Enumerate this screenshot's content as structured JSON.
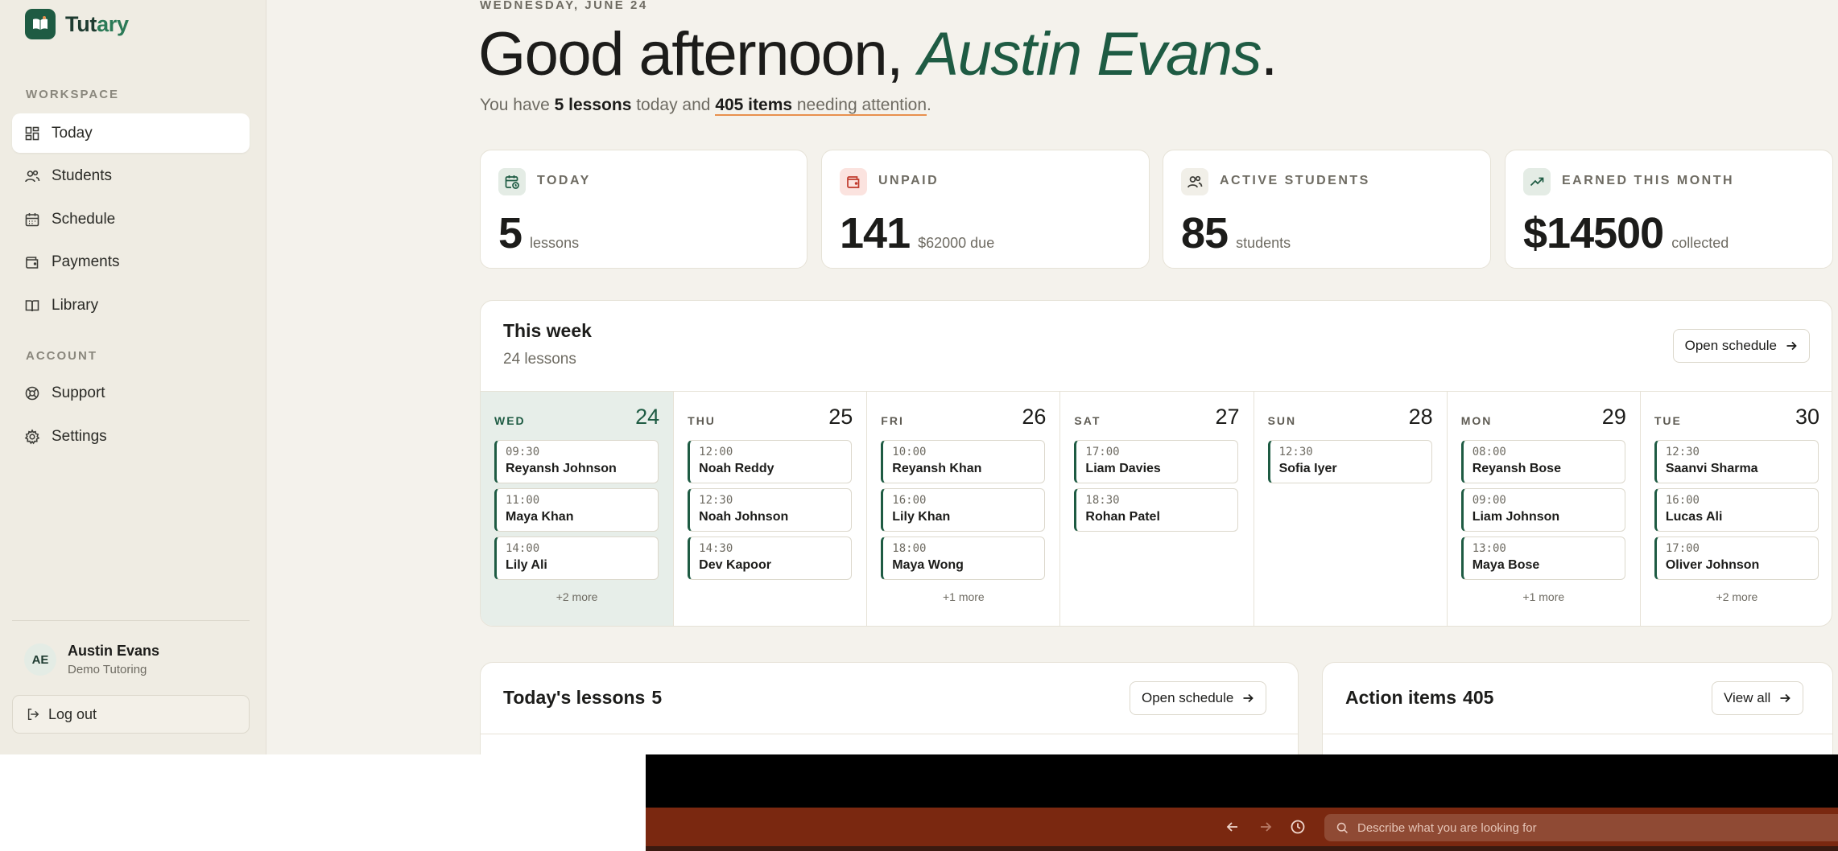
{
  "brand": {
    "name_start": "Tut",
    "name_end": "ary"
  },
  "sidebar": {
    "workspace_label": "WORKSPACE",
    "account_label": "ACCOUNT",
    "items": [
      {
        "label": "Today",
        "icon": "grid-icon"
      },
      {
        "label": "Students",
        "icon": "users-icon"
      },
      {
        "label": "Schedule",
        "icon": "calendar-icon"
      },
      {
        "label": "Payments",
        "icon": "wallet-icon"
      },
      {
        "label": "Library",
        "icon": "book-icon"
      },
      {
        "label": "Support",
        "icon": "lifebuoy-icon"
      },
      {
        "label": "Settings",
        "icon": "gear-icon"
      }
    ],
    "user": {
      "initials": "AE",
      "name": "Austin Evans",
      "org": "Demo Tutoring"
    },
    "logout_label": "Log out"
  },
  "header": {
    "date": "WEDNESDAY, JUNE 24",
    "greeting": "Good afternoon, ",
    "name": "Austin Evans",
    "period": ".",
    "summary": {
      "prefix": "You have ",
      "lessons": "5 lessons",
      "middle": " today and ",
      "items": "405 items",
      "suffix": " needing attention",
      "end": "."
    }
  },
  "stats": [
    {
      "label": "TODAY",
      "value": "5",
      "sub": "lessons",
      "icon": "calendar-clock-icon"
    },
    {
      "label": "UNPAID",
      "value": "141",
      "sub": "$62000 due",
      "icon": "wallet-icon"
    },
    {
      "label": "ACTIVE STUDENTS",
      "value": "85",
      "sub": "students",
      "icon": "users-icon"
    },
    {
      "label": "EARNED THIS MONTH",
      "value": "$14500",
      "sub": "collected",
      "icon": "trending-up-icon"
    }
  ],
  "week": {
    "title": "This week",
    "subtitle": "24 lessons",
    "button": "Open schedule",
    "days": [
      {
        "name": "WED",
        "num": "24",
        "today": true,
        "lessons": [
          {
            "time": "09:30",
            "name": "Reyansh Johnson"
          },
          {
            "time": "11:00",
            "name": "Maya Khan"
          },
          {
            "time": "14:00",
            "name": "Lily Ali"
          }
        ],
        "more": "+2 more"
      },
      {
        "name": "THU",
        "num": "25",
        "lessons": [
          {
            "time": "12:00",
            "name": "Noah Reddy"
          },
          {
            "time": "12:30",
            "name": "Noah Johnson"
          },
          {
            "time": "14:30",
            "name": "Dev Kapoor"
          }
        ],
        "more": ""
      },
      {
        "name": "FRI",
        "num": "26",
        "lessons": [
          {
            "time": "10:00",
            "name": "Reyansh Khan"
          },
          {
            "time": "16:00",
            "name": "Lily Khan"
          },
          {
            "time": "18:00",
            "name": "Maya Wong"
          }
        ],
        "more": "+1 more"
      },
      {
        "name": "SAT",
        "num": "27",
        "lessons": [
          {
            "time": "17:00",
            "name": "Liam Davies"
          },
          {
            "time": "18:30",
            "name": "Rohan Patel"
          }
        ],
        "more": ""
      },
      {
        "name": "SUN",
        "num": "28",
        "lessons": [
          {
            "time": "12:30",
            "name": "Sofia Iyer"
          }
        ],
        "more": ""
      },
      {
        "name": "MON",
        "num": "29",
        "lessons": [
          {
            "time": "08:00",
            "name": "Reyansh Bose"
          },
          {
            "time": "09:00",
            "name": "Liam Johnson"
          },
          {
            "time": "13:00",
            "name": "Maya Bose"
          }
        ],
        "more": "+1 more"
      },
      {
        "name": "TUE",
        "num": "30",
        "lessons": [
          {
            "time": "12:30",
            "name": "Saanvi Sharma"
          },
          {
            "time": "16:00",
            "name": "Lucas Ali"
          },
          {
            "time": "17:00",
            "name": "Oliver Johnson"
          }
        ],
        "more": "+2 more"
      }
    ]
  },
  "todays_lessons": {
    "title": "Today's lessons",
    "count": "5",
    "button": "Open schedule"
  },
  "action_items": {
    "title": "Action items",
    "count": "405",
    "button": "View all"
  },
  "browser": {
    "search_placeholder": "Describe what you are looking for"
  },
  "colors": {
    "accent": "#1e5b43",
    "background": "#f4f2ec",
    "underline": "#e8904e",
    "browser_bar": "#7a2810"
  }
}
